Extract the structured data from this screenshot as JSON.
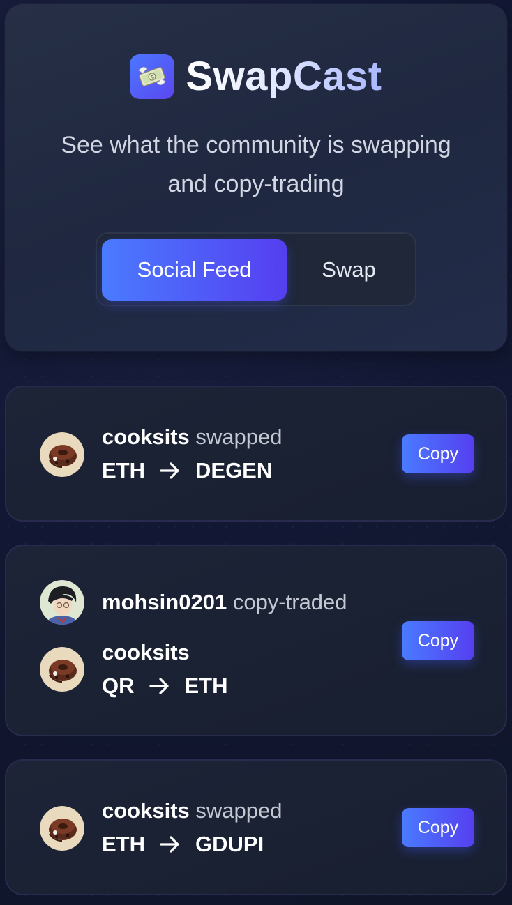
{
  "app": {
    "title": "SwapCast",
    "logo_icon": "money-with-wings-icon",
    "tagline": "See what the community is swapping and copy-trading"
  },
  "tabs": [
    {
      "label": "Social Feed",
      "active": true
    },
    {
      "label": "Swap",
      "active": false
    }
  ],
  "colors": {
    "accent_start": "#4a7bff",
    "accent_end": "#553ff0"
  },
  "feed": [
    {
      "user": "cooksits",
      "action": "swapped",
      "from_token": "ETH",
      "to_token": "DEGEN",
      "copy_label": "Copy"
    },
    {
      "user": "mohsin0201",
      "action": "copy-traded",
      "source_user": "cooksits",
      "from_token": "QR",
      "to_token": "ETH",
      "copy_label": "Copy"
    },
    {
      "user": "cooksits",
      "action": "swapped",
      "from_token": "ETH",
      "to_token": "GDUPI",
      "copy_label": "Copy"
    }
  ]
}
